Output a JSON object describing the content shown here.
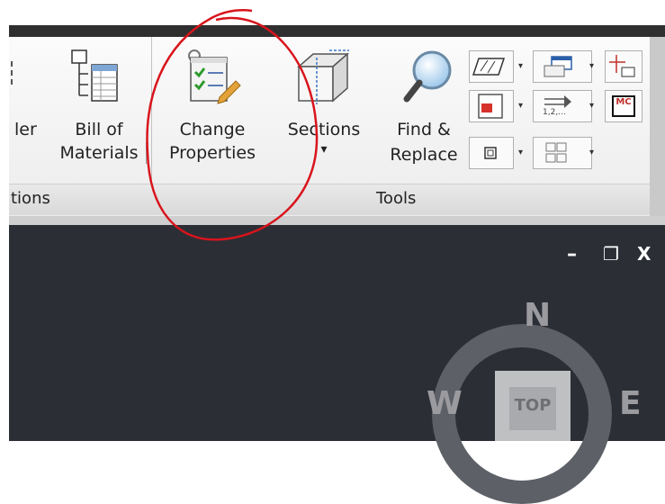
{
  "ribbon": {
    "partial_button_label": "ler",
    "bill_of_materials": {
      "line1": "Bill of",
      "line2": "Materials"
    },
    "change_properties": {
      "line1": "Change",
      "line2": "Properties"
    },
    "sections": {
      "label": "Sections",
      "dropdown": "▾"
    },
    "find_replace": {
      "line1": "Find &",
      "line2": "Replace"
    },
    "group_label_left": "tions",
    "group_label_tools": "Tools",
    "small_buttons": {
      "mc_label": "MC",
      "numbering_label": "1,2,...",
      "dropdown": "▾"
    }
  },
  "viewport": {
    "window_controls": {
      "minimize": "–",
      "restore": "❐",
      "close": "X"
    },
    "viewcube": {
      "north": "N",
      "west": "W",
      "east": "E",
      "face": "TOP"
    }
  },
  "colors": {
    "annotation_circle": "#d9141c",
    "viewport_bg": "#2b2e35"
  }
}
